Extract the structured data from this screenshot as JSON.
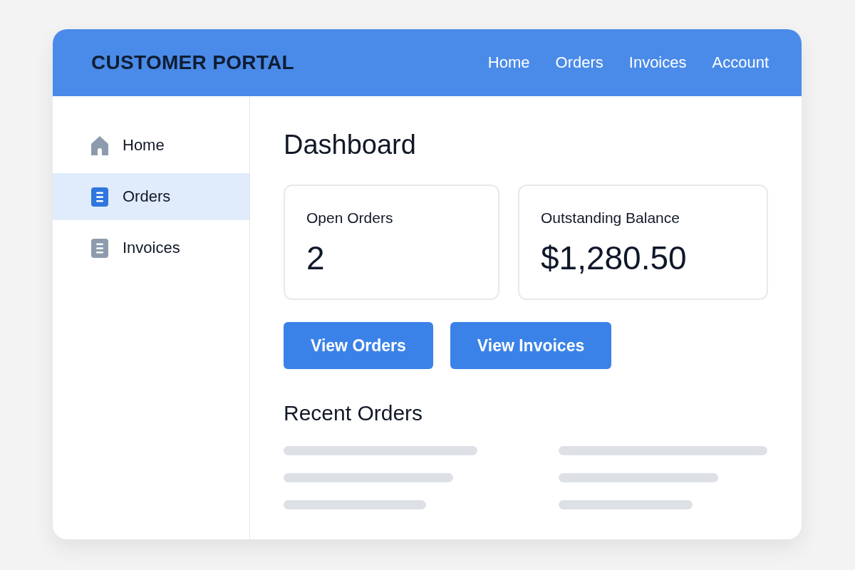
{
  "header": {
    "title": "CUSTOMER PORTAL",
    "nav": [
      "Home",
      "Orders",
      "Invoices",
      "Account"
    ]
  },
  "sidebar": {
    "items": [
      {
        "label": "Home",
        "kind": "home",
        "selected": false
      },
      {
        "label": "Orders",
        "kind": "document",
        "selected": true
      },
      {
        "label": "Invoices",
        "kind": "document",
        "selected": false
      }
    ]
  },
  "main": {
    "title": "Dashboard",
    "stats": [
      {
        "label": "Open Orders",
        "value": "2"
      },
      {
        "label": "Outstanding Balance",
        "value": "$1,280.50"
      }
    ],
    "actions": [
      "View Orders",
      "View Invoices"
    ],
    "recent": {
      "title": "Recent Orders"
    }
  }
}
